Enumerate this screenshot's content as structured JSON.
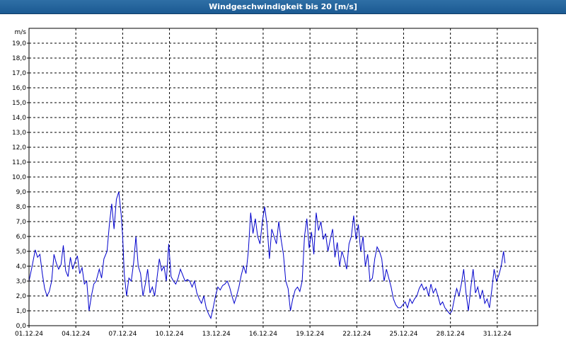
{
  "window": {
    "title": "Windgeschwindigkeit bis 20 [m/s]"
  },
  "chart_data": {
    "type": "line",
    "title": "Windgeschwindigkeit bis 20 [m/s]",
    "ylabel": "m/s",
    "xlabel": "",
    "ylim": [
      0,
      20
    ],
    "xlim": [
      0,
      33
    ],
    "grid": true,
    "line_color": "#0000cc",
    "y_ticks": [
      "0,0",
      "1,0",
      "2,0",
      "3,0",
      "4,0",
      "5,0",
      "6,0",
      "7,0",
      "8,0",
      "9,0",
      "10,0",
      "11,0",
      "12,0",
      "13,0",
      "14,0",
      "15,0",
      "16,0",
      "17,0",
      "18,0",
      "19,0"
    ],
    "x_ticks": [
      {
        "day": 0,
        "label": "01.12.24"
      },
      {
        "day": 3,
        "label": "04.12.24"
      },
      {
        "day": 6,
        "label": "07.12.24"
      },
      {
        "day": 9,
        "label": "10.12.24"
      },
      {
        "day": 12,
        "label": "13.12.24"
      },
      {
        "day": 15,
        "label": "16.12.24"
      },
      {
        "day": 18,
        "label": "19.12.24"
      },
      {
        "day": 21,
        "label": "22.12.24"
      },
      {
        "day": 24,
        "label": "25.12.24"
      },
      {
        "day": 27,
        "label": "28.12.24"
      },
      {
        "day": 30,
        "label": "31.12.24"
      }
    ],
    "series": [
      {
        "points": [
          [
            0.0,
            3.0
          ],
          [
            0.2,
            4.0
          ],
          [
            0.4,
            5.1
          ],
          [
            0.55,
            4.6
          ],
          [
            0.7,
            4.8
          ],
          [
            0.85,
            3.5
          ],
          [
            1.0,
            2.5
          ],
          [
            1.15,
            2.0
          ],
          [
            1.3,
            2.3
          ],
          [
            1.45,
            3.0
          ],
          [
            1.6,
            4.8
          ],
          [
            1.75,
            4.2
          ],
          [
            1.9,
            3.8
          ],
          [
            2.05,
            4.1
          ],
          [
            2.2,
            5.4
          ],
          [
            2.35,
            3.7
          ],
          [
            2.5,
            3.3
          ],
          [
            2.65,
            4.6
          ],
          [
            2.8,
            3.8
          ],
          [
            2.95,
            4.3
          ],
          [
            3.1,
            4.7
          ],
          [
            3.25,
            3.5
          ],
          [
            3.4,
            3.9
          ],
          [
            3.55,
            2.8
          ],
          [
            3.7,
            3.0
          ],
          [
            3.85,
            1.0
          ],
          [
            4.0,
            2.0
          ],
          [
            4.15,
            2.8
          ],
          [
            4.3,
            3.0
          ],
          [
            4.5,
            3.8
          ],
          [
            4.65,
            3.2
          ],
          [
            4.8,
            4.5
          ],
          [
            5.0,
            5.0
          ],
          [
            5.15,
            6.8
          ],
          [
            5.3,
            8.2
          ],
          [
            5.45,
            6.5
          ],
          [
            5.6,
            8.5
          ],
          [
            5.75,
            9.0
          ],
          [
            5.9,
            7.5
          ],
          [
            6.0,
            6.0
          ],
          [
            6.1,
            3.5
          ],
          [
            6.25,
            2.0
          ],
          [
            6.4,
            3.2
          ],
          [
            6.55,
            3.0
          ],
          [
            6.7,
            4.2
          ],
          [
            6.85,
            6.0
          ],
          [
            7.0,
            4.0
          ],
          [
            7.15,
            3.5
          ],
          [
            7.3,
            2.0
          ],
          [
            7.45,
            2.8
          ],
          [
            7.6,
            3.8
          ],
          [
            7.75,
            2.2
          ],
          [
            7.9,
            2.6
          ],
          [
            8.05,
            2.0
          ],
          [
            8.2,
            3.2
          ],
          [
            8.35,
            4.5
          ],
          [
            8.5,
            3.7
          ],
          [
            8.65,
            4.0
          ],
          [
            8.8,
            3.0
          ],
          [
            8.95,
            5.5
          ],
          [
            9.1,
            3.3
          ],
          [
            9.25,
            3.0
          ],
          [
            9.4,
            2.8
          ],
          [
            9.55,
            3.2
          ],
          [
            9.7,
            3.8
          ],
          [
            9.85,
            3.4
          ],
          [
            10.0,
            3.0
          ],
          [
            10.15,
            3.1
          ],
          [
            10.3,
            3.0
          ],
          [
            10.45,
            2.6
          ],
          [
            10.6,
            3.0
          ],
          [
            10.75,
            2.2
          ],
          [
            10.9,
            1.8
          ],
          [
            11.05,
            1.5
          ],
          [
            11.2,
            2.0
          ],
          [
            11.35,
            1.2
          ],
          [
            11.5,
            0.8
          ],
          [
            11.65,
            0.5
          ],
          [
            11.8,
            1.2
          ],
          [
            11.95,
            2.0
          ],
          [
            12.1,
            2.6
          ],
          [
            12.25,
            2.4
          ],
          [
            12.4,
            2.7
          ],
          [
            12.55,
            2.8
          ],
          [
            12.7,
            3.0
          ],
          [
            12.85,
            2.6
          ],
          [
            13.0,
            2.0
          ],
          [
            13.15,
            1.5
          ],
          [
            13.3,
            2.0
          ],
          [
            13.45,
            2.6
          ],
          [
            13.6,
            3.4
          ],
          [
            13.75,
            4.0
          ],
          [
            13.9,
            3.5
          ],
          [
            14.05,
            5.0
          ],
          [
            14.2,
            7.6
          ],
          [
            14.35,
            6.2
          ],
          [
            14.5,
            7.2
          ],
          [
            14.65,
            6.0
          ],
          [
            14.8,
            5.5
          ],
          [
            14.95,
            7.0
          ],
          [
            15.1,
            8.0
          ],
          [
            15.25,
            6.8
          ],
          [
            15.4,
            4.5
          ],
          [
            15.55,
            6.5
          ],
          [
            15.7,
            6.0
          ],
          [
            15.85,
            5.5
          ],
          [
            16.0,
            7.0
          ],
          [
            16.15,
            5.8
          ],
          [
            16.3,
            4.8
          ],
          [
            16.45,
            3.0
          ],
          [
            16.6,
            2.5
          ],
          [
            16.75,
            1.0
          ],
          [
            16.9,
            1.8
          ],
          [
            17.05,
            2.4
          ],
          [
            17.2,
            2.6
          ],
          [
            17.35,
            2.3
          ],
          [
            17.5,
            3.0
          ],
          [
            17.65,
            6.0
          ],
          [
            17.8,
            7.2
          ],
          [
            17.95,
            5.2
          ],
          [
            18.1,
            6.3
          ],
          [
            18.25,
            4.8
          ],
          [
            18.4,
            7.6
          ],
          [
            18.55,
            6.4
          ],
          [
            18.7,
            7.0
          ],
          [
            18.85,
            5.8
          ],
          [
            19.0,
            6.2
          ],
          [
            19.15,
            5.0
          ],
          [
            19.3,
            5.8
          ],
          [
            19.45,
            6.5
          ],
          [
            19.6,
            4.6
          ],
          [
            19.75,
            5.6
          ],
          [
            19.9,
            4.0
          ],
          [
            20.05,
            5.0
          ],
          [
            20.2,
            4.5
          ],
          [
            20.35,
            3.8
          ],
          [
            20.5,
            5.5
          ],
          [
            20.65,
            6.0
          ],
          [
            20.8,
            7.4
          ],
          [
            20.95,
            5.8
          ],
          [
            21.1,
            6.8
          ],
          [
            21.25,
            5.0
          ],
          [
            21.4,
            6.0
          ],
          [
            21.55,
            4.0
          ],
          [
            21.7,
            4.8
          ],
          [
            21.85,
            3.0
          ],
          [
            22.0,
            3.2
          ],
          [
            22.15,
            4.5
          ],
          [
            22.3,
            5.3
          ],
          [
            22.45,
            5.0
          ],
          [
            22.6,
            4.5
          ],
          [
            22.75,
            3.0
          ],
          [
            22.9,
            3.8
          ],
          [
            23.05,
            3.2
          ],
          [
            23.2,
            2.6
          ],
          [
            23.35,
            1.8
          ],
          [
            23.5,
            1.4
          ],
          [
            23.65,
            1.2
          ],
          [
            23.8,
            1.2
          ],
          [
            23.95,
            1.4
          ],
          [
            24.1,
            1.6
          ],
          [
            24.25,
            1.2
          ],
          [
            24.4,
            1.8
          ],
          [
            24.55,
            1.5
          ],
          [
            24.7,
            1.8
          ],
          [
            24.85,
            2.0
          ],
          [
            25.0,
            2.5
          ],
          [
            25.15,
            2.8
          ],
          [
            25.3,
            2.4
          ],
          [
            25.45,
            2.6
          ],
          [
            25.6,
            2.0
          ],
          [
            25.75,
            2.8
          ],
          [
            25.9,
            2.2
          ],
          [
            26.05,
            2.5
          ],
          [
            26.2,
            2.0
          ],
          [
            26.35,
            1.4
          ],
          [
            26.5,
            1.6
          ],
          [
            26.65,
            1.2
          ],
          [
            26.8,
            1.0
          ],
          [
            26.95,
            0.8
          ],
          [
            27.1,
            1.0
          ],
          [
            27.25,
            1.8
          ],
          [
            27.4,
            2.5
          ],
          [
            27.55,
            2.0
          ],
          [
            27.7,
            2.8
          ],
          [
            27.85,
            3.8
          ],
          [
            28.0,
            2.2
          ],
          [
            28.15,
            1.0
          ],
          [
            28.3,
            2.5
          ],
          [
            28.45,
            3.8
          ],
          [
            28.6,
            2.2
          ],
          [
            28.75,
            2.6
          ],
          [
            28.9,
            1.8
          ],
          [
            29.05,
            2.4
          ],
          [
            29.2,
            1.5
          ],
          [
            29.35,
            1.8
          ],
          [
            29.5,
            1.2
          ],
          [
            29.65,
            2.4
          ],
          [
            29.8,
            3.8
          ],
          [
            29.95,
            3.0
          ],
          [
            30.1,
            3.4
          ],
          [
            30.25,
            4.0
          ],
          [
            30.4,
            5.0
          ],
          [
            30.5,
            4.2
          ]
        ]
      }
    ]
  }
}
